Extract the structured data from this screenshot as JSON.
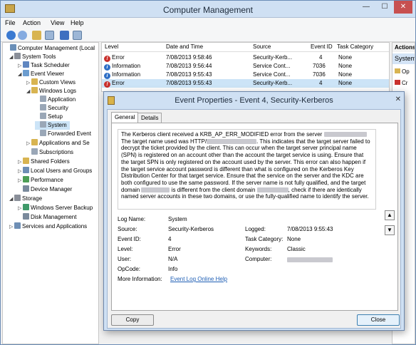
{
  "window": {
    "title": "Computer Management",
    "minimize": "—",
    "maximize": "☐",
    "close": "✕"
  },
  "menu": [
    "File",
    "Action",
    "View",
    "Help"
  ],
  "tree": [
    {
      "label": "Computer Management (Local",
      "expander": "",
      "icon_color": "#6a8fb8",
      "sel": false
    },
    {
      "label": "System Tools",
      "expander": "◢",
      "icon_color": "#8a8f99",
      "sel": false
    },
    {
      "label": "Task Scheduler",
      "expander": "▷",
      "icon_color": "#5f86c0",
      "sel": false
    },
    {
      "label": "Event Viewer",
      "expander": "◢",
      "icon_color": "#6b9ccf",
      "sel": false
    },
    {
      "label": "Custom Views",
      "expander": "▷",
      "icon_color": "#d8b451",
      "sel": false
    },
    {
      "label": "Windows Logs",
      "expander": "◢",
      "icon_color": "#d8b451",
      "sel": false
    },
    {
      "label": "Application",
      "expander": "",
      "icon_color": "#9aa7b7",
      "sel": false
    },
    {
      "label": "Security",
      "expander": "",
      "icon_color": "#9aa7b7",
      "sel": false
    },
    {
      "label": "Setup",
      "expander": "",
      "icon_color": "#9aa7b7",
      "sel": false
    },
    {
      "label": "System",
      "expander": "",
      "icon_color": "#9aa7b7",
      "sel": true
    },
    {
      "label": "Forwarded Event",
      "expander": "",
      "icon_color": "#9aa7b7",
      "sel": false
    },
    {
      "label": "Applications and Se",
      "expander": "▷",
      "icon_color": "#d8b451",
      "sel": false
    },
    {
      "label": "Subscriptions",
      "expander": "",
      "icon_color": "#9aa7b7",
      "sel": false
    },
    {
      "label": "Shared Folders",
      "expander": "▷",
      "icon_color": "#d8b451",
      "sel": false
    },
    {
      "label": "Local Users and Groups",
      "expander": "▷",
      "icon_color": "#6f8fb5",
      "sel": false
    },
    {
      "label": "Performance",
      "expander": "▷",
      "icon_color": "#4d9e56",
      "sel": false
    },
    {
      "label": "Device Manager",
      "expander": "",
      "icon_color": "#7a8a9c",
      "sel": false
    },
    {
      "label": "Storage",
      "expander": "◢",
      "icon_color": "#8a8f99",
      "sel": false
    },
    {
      "label": "Windows Server Backup",
      "expander": "▷",
      "icon_color": "#3f9a6a",
      "sel": false
    },
    {
      "label": "Disk Management",
      "expander": "",
      "icon_color": "#7a8a9c",
      "sel": false
    },
    {
      "label": "Services and Applications",
      "expander": "▷",
      "icon_color": "#6f8fb5",
      "sel": false
    }
  ],
  "list": {
    "headers": [
      "Level",
      "Date and Time",
      "Source",
      "Event ID",
      "Task Category"
    ],
    "rows": [
      {
        "level": "Error",
        "kind": "err",
        "date": "7/08/2013 9:58:46",
        "source": "Security-Kerb...",
        "id": "4",
        "cat": "None"
      },
      {
        "level": "Information",
        "kind": "inf",
        "date": "7/08/2013 9:56:44",
        "source": "Service Cont...",
        "id": "7036",
        "cat": "None"
      },
      {
        "level": "Information",
        "kind": "inf",
        "date": "7/08/2013 9:55:43",
        "source": "Service Cont...",
        "id": "7036",
        "cat": "None"
      },
      {
        "level": "Error",
        "kind": "err",
        "date": "7/08/2013 9:55:43",
        "source": "Security-Kerb...",
        "id": "4",
        "cat": "None"
      }
    ]
  },
  "actions": {
    "header": "Actions",
    "selected": "System",
    "items": [
      "Op",
      "Cr"
    ]
  },
  "dialog": {
    "title": "Event Properties - Event 4, Security-Kerberos",
    "tabs": [
      "General",
      "Details"
    ],
    "description": {
      "p1": "The Kerberos client received a KRB_AP_ERR_MODIFIED error from the server",
      "p2": "The target name used was HTTP/",
      "p3": ". This indicates that the target server failed to decrypt the ticket provided by the client. This can occur when the target server principal name (SPN) is registered on an account other than the account the target service is using. Ensure that the target SPN is only registered on the account used by the server. This error can also happen if the target service account password is different than what is configured on the Kerberos Key Distribution Center for that target service. Ensure that the service on the server and the KDC are both configured to use the same password. If the server name is not fully qualified, and the target domain",
      "p4": "is different from the client domain",
      "p5": ", check if there are identically named server accounts in these two domains, or use the fully-qualified name to identify the server."
    },
    "fields": {
      "log_name_label": "Log Name:",
      "log_name": "System",
      "source_label": "Source:",
      "source": "Security-Kerberos",
      "logged_label": "Logged:",
      "logged": "7/08/2013 9:55:43",
      "event_id_label": "Event ID:",
      "event_id": "4",
      "task_label": "Task Category:",
      "task": "None",
      "level_label": "Level:",
      "level": "Error",
      "keywords_label": "Keywords:",
      "keywords": "Classic",
      "user_label": "User:",
      "user": "N/A",
      "computer_label": "Computer:",
      "opcode_label": "OpCode:",
      "opcode": "Info",
      "more_label": "More Information:",
      "more_link": "Event Log Online Help"
    },
    "copy_label": "Copy",
    "close_label": "Close"
  }
}
